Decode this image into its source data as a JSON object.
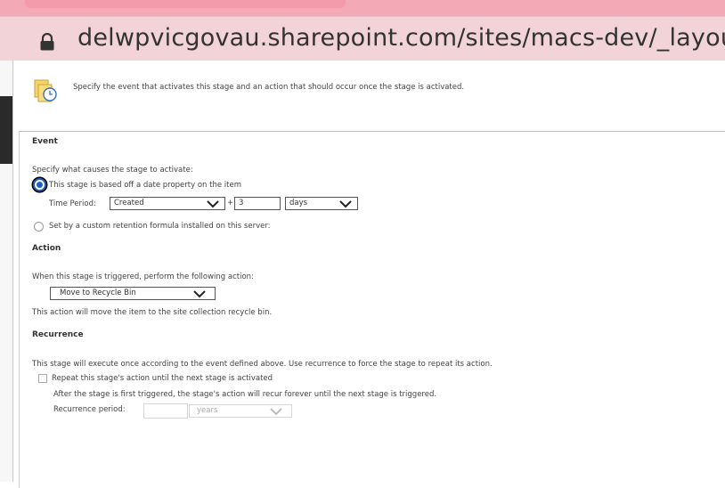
{
  "browser": {
    "url": "delwpvicgovau.sharepoint.com/sites/macs-dev/_layou"
  },
  "info": {
    "text": "Specify the event that activates this stage and an action that should occur once the stage is activated."
  },
  "event": {
    "heading": "Event",
    "prompt": "Specify what causes the stage to activate:",
    "option_date": "This stage is based off a date property on the item",
    "time_period_label": "Time Period:",
    "time_period_value": "Created",
    "plus": "+",
    "offset_value": "3",
    "unit_value": "days",
    "option_custom": "Set by a custom retention formula installed on this server:"
  },
  "action": {
    "heading": "Action",
    "prompt": "When this stage is triggered, perform the following action:",
    "selected": "Move to Recycle Bin",
    "description": "This action will move the item to the site collection recycle bin."
  },
  "recurrence": {
    "heading": "Recurrence",
    "description": "This stage will execute once according to the event defined above. Use recurrence to force the stage to repeat its action.",
    "checkbox_label": "Repeat this stage's action until the next stage is activated",
    "note": "After the stage is first triggered, the stage's action will recur forever until the next stage is triggered.",
    "period_label": "Recurrence period:",
    "period_unit": "years"
  }
}
